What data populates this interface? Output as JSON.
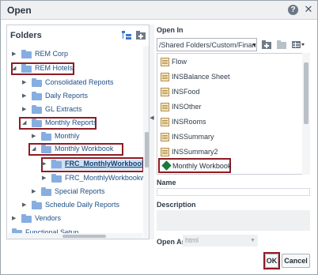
{
  "dialog": {
    "title": "Open",
    "help_symbol": "?",
    "close_symbol": "✕"
  },
  "folders": {
    "title": "Folders",
    "tree": [
      {
        "label": "REM Corp",
        "expanded": false
      },
      {
        "label": "REM Hotels",
        "expanded": true
      },
      {
        "label": "Consolidated Reports",
        "expanded": false
      },
      {
        "label": "Daily Reports",
        "expanded": false
      },
      {
        "label": "GL Extracts",
        "expanded": false
      },
      {
        "label": "Monthly Reports",
        "expanded": true
      },
      {
        "label": "Monthly",
        "expanded": false
      },
      {
        "label": "Monthly Workbook",
        "expanded": true
      },
      {
        "label": "FRC_MonthlyWorkbook",
        "expanded": false,
        "selected": true
      },
      {
        "label": "FRC_MonthlyWorkbookw",
        "expanded": false
      },
      {
        "label": "Special Reports",
        "expanded": false
      },
      {
        "label": "Schedule Daily Reports",
        "expanded": false
      },
      {
        "label": "Vendors",
        "expanded": false
      },
      {
        "label": "Functional Setup",
        "expanded": false
      }
    ]
  },
  "open_in": {
    "label": "Open In",
    "path": "/Shared Folders/Custom/Finan",
    "items": [
      "Flow",
      "INSBalance Sheet",
      "INSFood",
      "INSOther",
      "INSRooms",
      "INSSummary",
      "INSSummary2"
    ],
    "selected_item": "Monthly Workbook"
  },
  "fields": {
    "name_label": "Name",
    "name_value": "",
    "description_label": "Description",
    "open_as_label": "Open As",
    "open_as_value": "html"
  },
  "buttons": {
    "ok": "OK",
    "cancel": "Cancel"
  },
  "colors": {
    "highlight": "#8e1b24",
    "folder": "#86aee0",
    "link": "#1f4f86",
    "selection": "#cfe1f5"
  },
  "icons": [
    "help-icon",
    "close-icon",
    "new-folder-icon",
    "folder-up-icon",
    "view-icon",
    "folder-icon",
    "workbook-icon",
    "document-icon"
  ]
}
